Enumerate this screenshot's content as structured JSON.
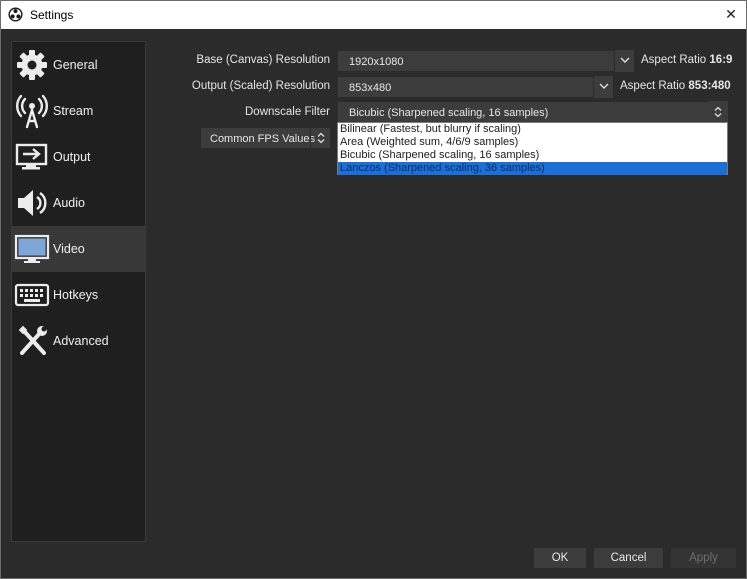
{
  "window": {
    "title": "Settings",
    "close_glyph": "✕"
  },
  "sidebar": {
    "items": [
      {
        "label": "General",
        "icon": "gear-icon"
      },
      {
        "label": "Stream",
        "icon": "broadcast-antenna-icon"
      },
      {
        "label": "Output",
        "icon": "output-screen-icon"
      },
      {
        "label": "Audio",
        "icon": "speaker-icon"
      },
      {
        "label": "Video",
        "icon": "monitor-icon",
        "active": true
      },
      {
        "label": "Hotkeys",
        "icon": "keyboard-icon"
      },
      {
        "label": "Advanced",
        "icon": "wrench-screwdriver-icon"
      }
    ]
  },
  "video": {
    "base_resolution": {
      "label": "Base (Canvas) Resolution",
      "value": "1920x1080",
      "aspect_label": "Aspect Ratio",
      "aspect_value": "16:9"
    },
    "output_resolution": {
      "label": "Output (Scaled) Resolution",
      "value": "853x480",
      "aspect_label": "Aspect Ratio",
      "aspect_value": "853:480"
    },
    "downscale_filter": {
      "label": "Downscale Filter",
      "value": "Bicubic (Sharpened scaling, 16 samples)",
      "options": [
        "Bilinear (Fastest, but blurry if scaling)",
        "Area (Weighted sum, 4/6/9 samples)",
        "Bicubic (Sharpened scaling, 16 samples)",
        "Lanczos (Sharpened scaling, 36 samples)"
      ],
      "highlighted_option": "Lanczos (Sharpened scaling, 36 samples)"
    },
    "fps": {
      "value": "Common FPS Values"
    }
  },
  "buttons": {
    "ok": "OK",
    "cancel": "Cancel",
    "apply": "Apply"
  },
  "colors": {
    "background": "#2b2b2b",
    "sidebar": "#1f1f1f",
    "control": "#3c3c3c",
    "highlight": "#1c6fd6"
  }
}
